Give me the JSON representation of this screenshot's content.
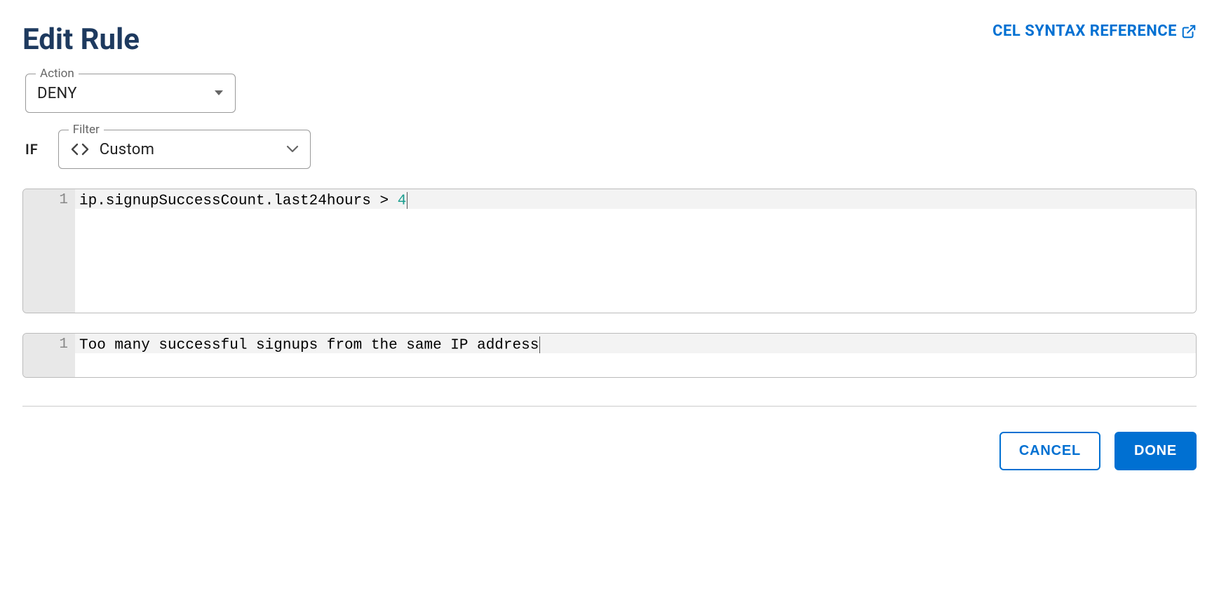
{
  "header": {
    "title": "Edit Rule",
    "syntax_link": "CEL SYNTAX REFERENCE"
  },
  "action": {
    "label": "Action",
    "value": "DENY"
  },
  "condition": {
    "if_label": "IF",
    "filter_label": "Filter",
    "filter_value": "Custom"
  },
  "editor1": {
    "line_number": "1",
    "code_prefix": "ip.signupSuccessCount.last24hours > ",
    "code_number": "4"
  },
  "editor2": {
    "line_number": "1",
    "message": "Too many successful signups from the same IP address"
  },
  "footer": {
    "cancel": "CANCEL",
    "done": "DONE"
  }
}
